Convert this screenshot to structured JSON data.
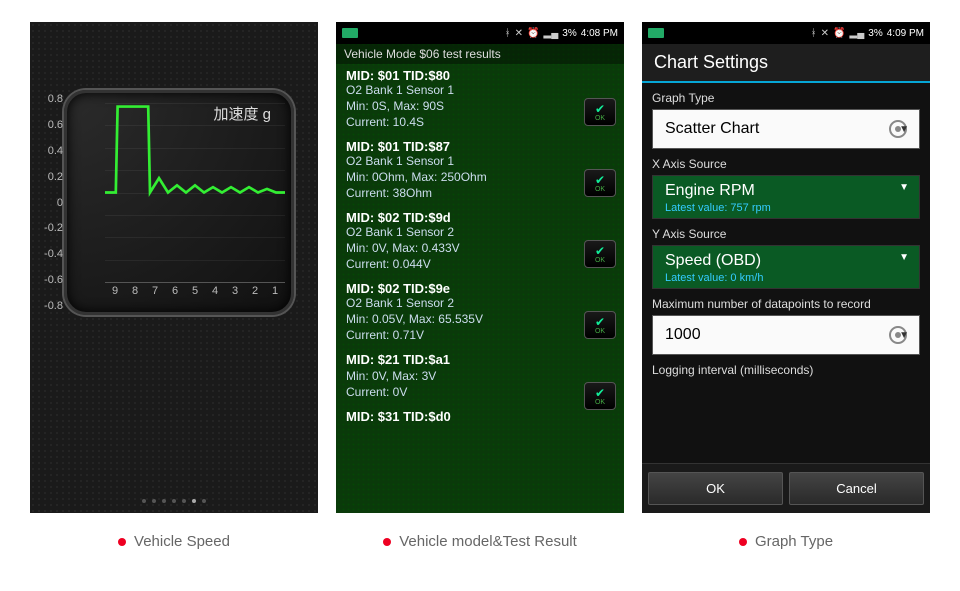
{
  "status_bar": {
    "battery": "3%",
    "time1": "4:08 PM",
    "time2": "4:09 PM"
  },
  "phone1": {
    "title": "加速度 g",
    "y_ticks": [
      "0.8",
      "0.6",
      "0.4",
      "0.2",
      "0",
      "-0.2",
      "-0.4",
      "-0.6",
      "-0.8"
    ],
    "x_ticks": [
      "9",
      "8",
      "7",
      "6",
      "5",
      "4",
      "3",
      "2",
      "1"
    ]
  },
  "phone2": {
    "header": "Vehicle Mode $06 test results",
    "items": [
      {
        "mid": "MID: $01 TID:$80",
        "bank": "O2 Bank 1 Sensor 1",
        "minmax": "Min: 0S, Max: 90S",
        "cur": "Current: 10.4S"
      },
      {
        "mid": "MID: $01 TID:$87",
        "bank": "O2 Bank 1 Sensor 1",
        "minmax": "Min: 0Ohm, Max: 250Ohm",
        "cur": "Current: 38Ohm"
      },
      {
        "mid": "MID: $02 TID:$9d",
        "bank": "O2 Bank 1 Sensor 2",
        "minmax": "Min: 0V, Max: 0.433V",
        "cur": "Current: 0.044V"
      },
      {
        "mid": "MID: $02 TID:$9e",
        "bank": "O2 Bank 1 Sensor 2",
        "minmax": "Min: 0.05V, Max: 65.535V",
        "cur": "Current: 0.71V"
      },
      {
        "mid": "MID: $21 TID:$a1",
        "bank": "",
        "minmax": "Min: 0V, Max: 3V",
        "cur": "Current: 0V"
      },
      {
        "mid": "MID: $31 TID:$d0",
        "bank": "",
        "minmax": "",
        "cur": ""
      }
    ],
    "ok_label": "OK"
  },
  "phone3": {
    "bc": "",
    "title": "Chart Settings",
    "graph_type_label": "Graph Type",
    "graph_type_value": "Scatter Chart",
    "x_label": "X Axis Source",
    "x_value": "Engine RPM",
    "x_latest": "Latest value: 757 rpm",
    "y_label": "Y Axis Source",
    "y_value": "Speed (OBD)",
    "y_latest": "Latest value: 0 km/h",
    "max_label": "Maximum number of datapoints to record",
    "max_value": "1000",
    "interval_label": "Logging interval (milliseconds)",
    "ok": "OK",
    "cancel": "Cancel"
  },
  "captions": {
    "c1": "Vehicle Speed",
    "c2": "Vehicle model&Test Result",
    "c3": "Graph Type"
  },
  "chart_data": {
    "type": "line",
    "title": "加速度 g",
    "x": [
      9,
      8,
      7,
      6,
      5,
      4,
      3,
      2,
      1
    ],
    "y": [
      0,
      0.8,
      0.8,
      0.05,
      0.1,
      0.05,
      0.1,
      0.05,
      0.05
    ],
    "ylim": [
      -0.8,
      0.8
    ],
    "xlabel": "",
    "ylabel": ""
  }
}
